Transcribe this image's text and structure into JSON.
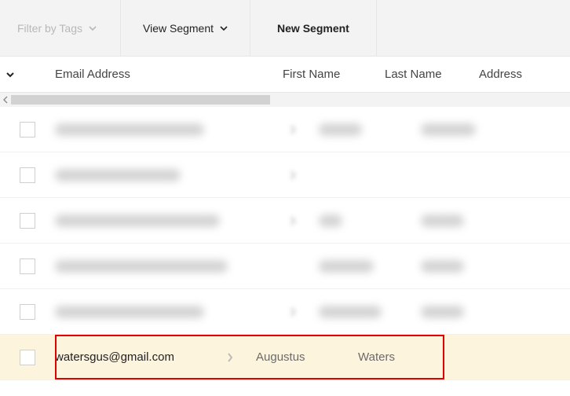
{
  "toolbar": {
    "filter_label": "Filter by Tags",
    "view_label": "View Segment",
    "new_label": "New Segment"
  },
  "columns": {
    "email": "Email Address",
    "first": "First Name",
    "last": "Last Name",
    "address": "Address"
  },
  "rows": [
    {
      "redacted": true
    },
    {
      "redacted": true
    },
    {
      "redacted": true
    },
    {
      "redacted": true
    },
    {
      "redacted": true
    },
    {
      "redacted": false,
      "email": "watersgus@gmail.com",
      "first": "Augustus",
      "last": "Waters"
    }
  ]
}
